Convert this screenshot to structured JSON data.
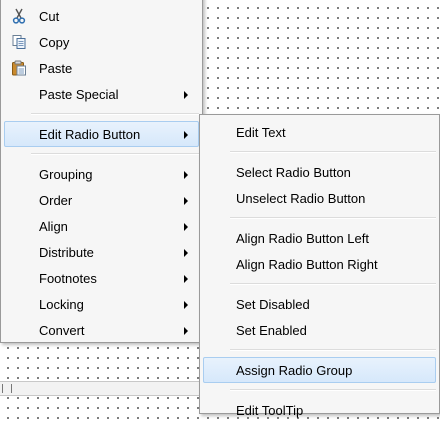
{
  "main_menu": {
    "cut": "Cut",
    "copy": "Copy",
    "paste": "Paste",
    "paste_special": "Paste Special",
    "edit_radio_button": "Edit Radio Button",
    "grouping": "Grouping",
    "order": "Order",
    "align": "Align",
    "distribute": "Distribute",
    "footnotes": "Footnotes",
    "locking": "Locking",
    "convert": "Convert"
  },
  "submenu": {
    "edit_text": "Edit Text",
    "select_radio_button": "Select Radio Button",
    "unselect_radio_button": "Unselect Radio Button",
    "align_radio_button_left": "Align Radio Button Left",
    "align_radio_button_right": "Align Radio Button Right",
    "set_disabled": "Set Disabled",
    "set_enabled": "Set Enabled",
    "assign_radio_group": "Assign Radio Group",
    "edit_tooltip": "Edit ToolTip"
  },
  "icons": {
    "cut": "scissors-icon",
    "copy": "copy-icon",
    "paste": "clipboard-icon"
  },
  "colors": {
    "highlight_fill": "#d6e8fb",
    "highlight_border": "#a9cdf0",
    "menu_background": "#f6f6f6"
  }
}
